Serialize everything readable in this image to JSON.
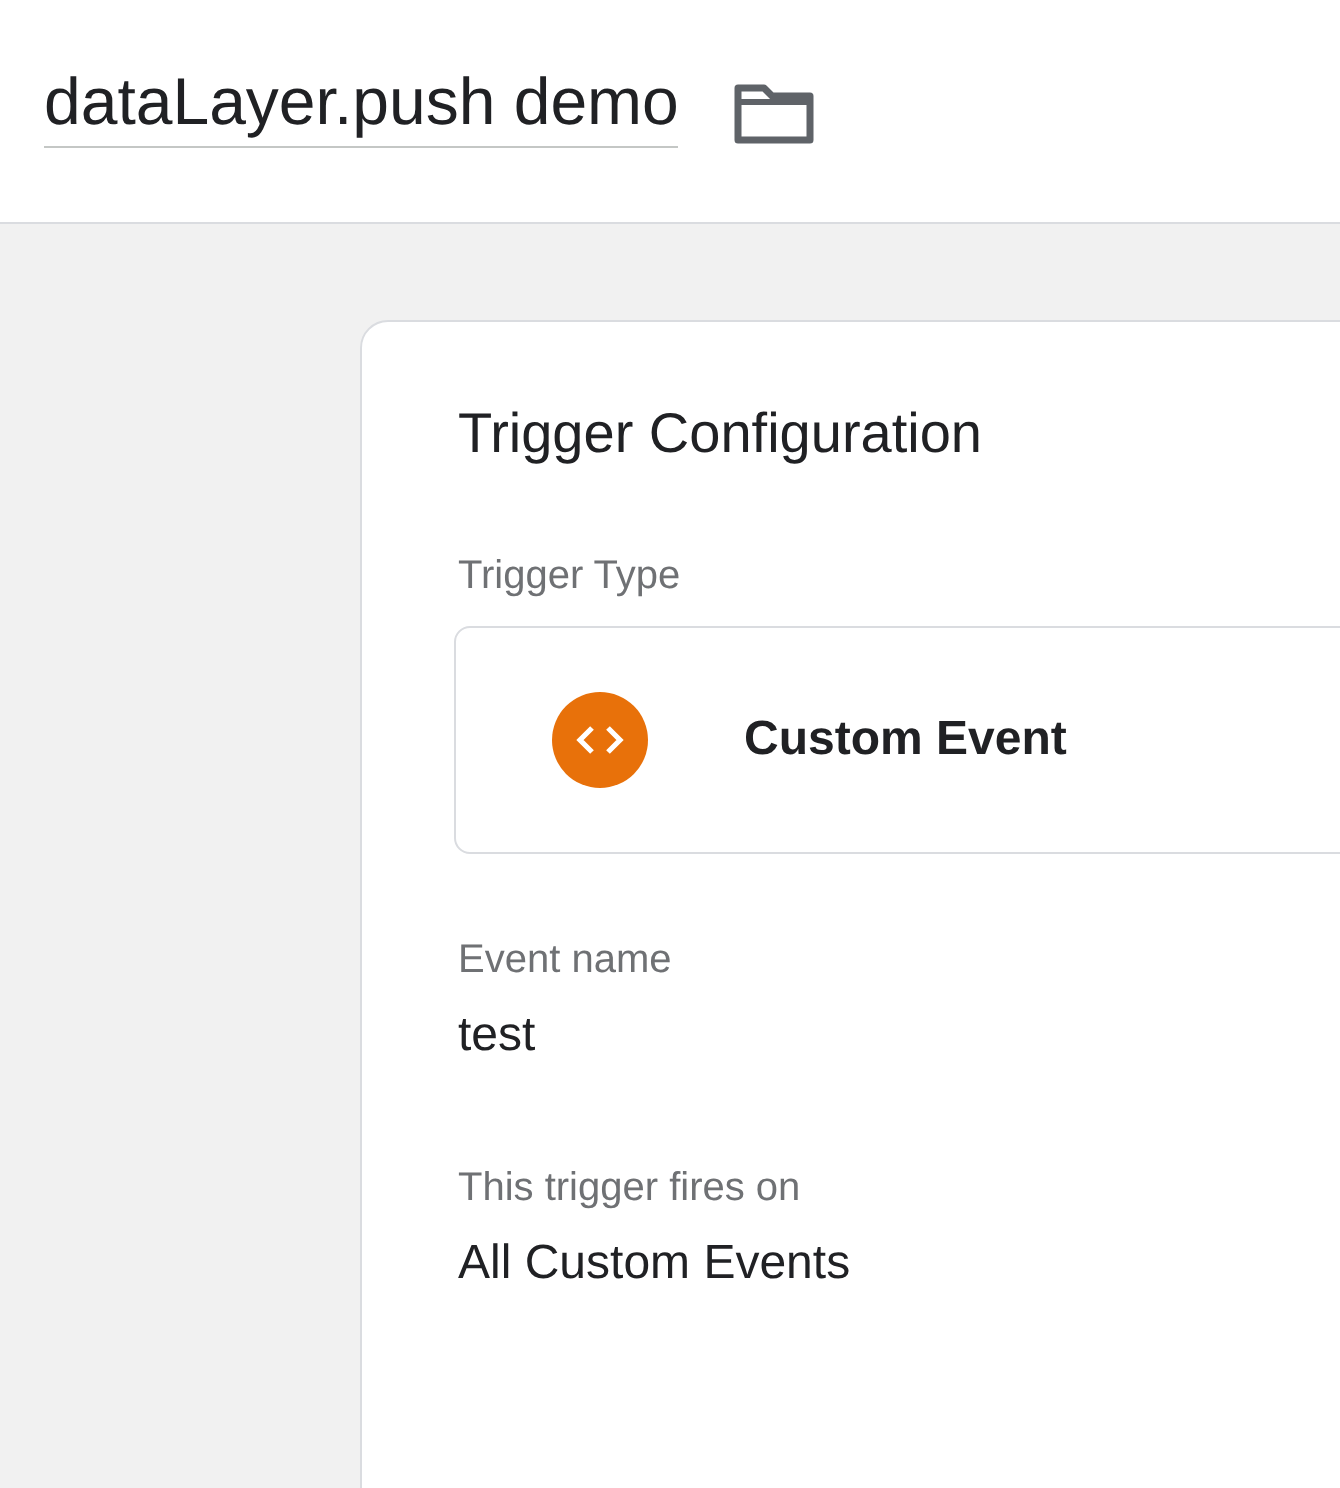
{
  "header": {
    "title": "dataLayer.push demo"
  },
  "card": {
    "title": "Trigger Configuration",
    "trigger_type": {
      "label": "Trigger Type",
      "kind": "custom_event",
      "value": "Custom Event"
    },
    "fields": [
      {
        "label": "Event name",
        "value": "test"
      },
      {
        "label": "This trigger fires on",
        "value": "All Custom Events"
      }
    ]
  }
}
